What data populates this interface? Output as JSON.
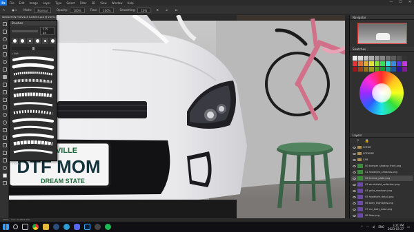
{
  "app": {
    "logo": "Ps",
    "menu": [
      "File",
      "Edit",
      "Image",
      "Layer",
      "Type",
      "Select",
      "Filter",
      "3D",
      "View",
      "Window",
      "Help"
    ],
    "window_controls": [
      "—",
      "☐",
      "✕"
    ]
  },
  "options": {
    "mode_label": "Mode:",
    "mode_value": "Normal",
    "opacity_label": "Opacity:",
    "opacity_value": "100%",
    "flow_label": "Flow:",
    "flow_value": "100%",
    "smoothing_label": "Smoothing:",
    "smoothing_value": "10%"
  },
  "document": {
    "tab_title": "SINGLETON FOXVILLE ILLINOIS.psd @ 200% (RGB/8)"
  },
  "brushes": {
    "title": "Brushes",
    "size_value": "175 px",
    "folder_label": "▸ Soft",
    "folder2_label": "▸ Hard"
  },
  "panels": {
    "navigator_title": "Navigator",
    "swatches_title": "Swatches",
    "layers_title": "Layers"
  },
  "layers": [
    {
      "name": "SCENE",
      "kind": "folder",
      "color": "#888888"
    },
    {
      "name": "SCENERY",
      "kind": "folder",
      "color": "#888888"
    },
    {
      "name": "CAR",
      "kind": "folder",
      "color": "#888888"
    },
    {
      "name": "00 bumper_shadow_front.png",
      "kind": "layer",
      "color": "#3d8a3d"
    },
    {
      "name": "01 headlight_shadows.png",
      "kind": "layer",
      "color": "#3d8a3d"
    },
    {
      "name": "02 license_plate.png",
      "kind": "layer",
      "color": "#3d8a3d"
    },
    {
      "name": "03 windshield_reflection.png",
      "kind": "layer",
      "color": "#6b4aa2"
    },
    {
      "name": "04 grille_shadows.png",
      "kind": "layer",
      "color": "#6b4aa2"
    },
    {
      "name": "05 headlight_detail.png",
      "kind": "layer",
      "color": "#6b4aa2"
    },
    {
      "name": "06 body_highlights.png",
      "kind": "layer",
      "color": "#6b4aa2"
    },
    {
      "name": "07 car_body_base.png",
      "kind": "layer",
      "color": "#6b4aa2"
    },
    {
      "name": "08 floor.png",
      "kind": "layer",
      "color": "#6b4aa2"
    }
  ],
  "canvas": {
    "plate_top": "ERVILLE",
    "plate_main": "DTF MOM",
    "plate_bottom": "DREAM STATE"
  },
  "status": {
    "zoom": "200%",
    "doc_size": "Doc: 24.9M/1.35G"
  },
  "taskbar": {
    "lang": "ENG",
    "time": "3:21 PM",
    "date": "2023-03-27"
  },
  "colors": {
    "accent": "#1473e6",
    "car_body": "#f0f0f2",
    "bike_frame": "#d26f89",
    "stool": "#3f6a4c"
  }
}
